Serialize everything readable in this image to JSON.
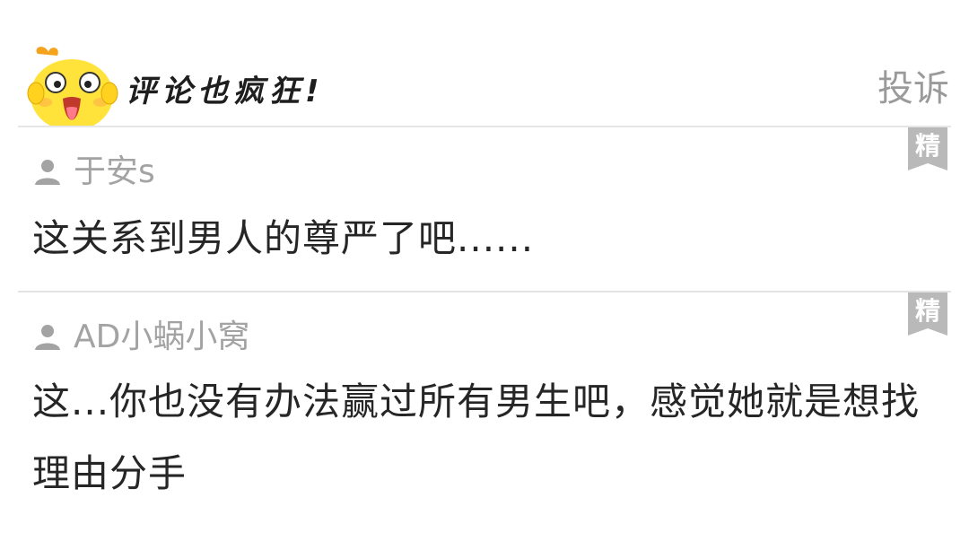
{
  "header": {
    "title": "评论也疯狂!",
    "report_label": "投诉",
    "mascot_icon": "yellow-chick-mascot-icon"
  },
  "comments": [
    {
      "username": "于安s",
      "text": "这关系到男人的尊严了吧......",
      "badge": "精",
      "user_icon": "user-silhouette-icon"
    },
    {
      "username": "AD小蜗小窝",
      "text": "这...你也没有办法赢过所有男生吧，感觉她就是想找理由分手",
      "badge": "精",
      "user_icon": "user-silhouette-icon"
    }
  ],
  "colors": {
    "badge_gray": "#b9b9b9",
    "username_gray": "#a3a3a3",
    "text_dark": "#262626",
    "mascot_yellow": "#ffe23a",
    "mascot_orange": "#f5a21d"
  }
}
